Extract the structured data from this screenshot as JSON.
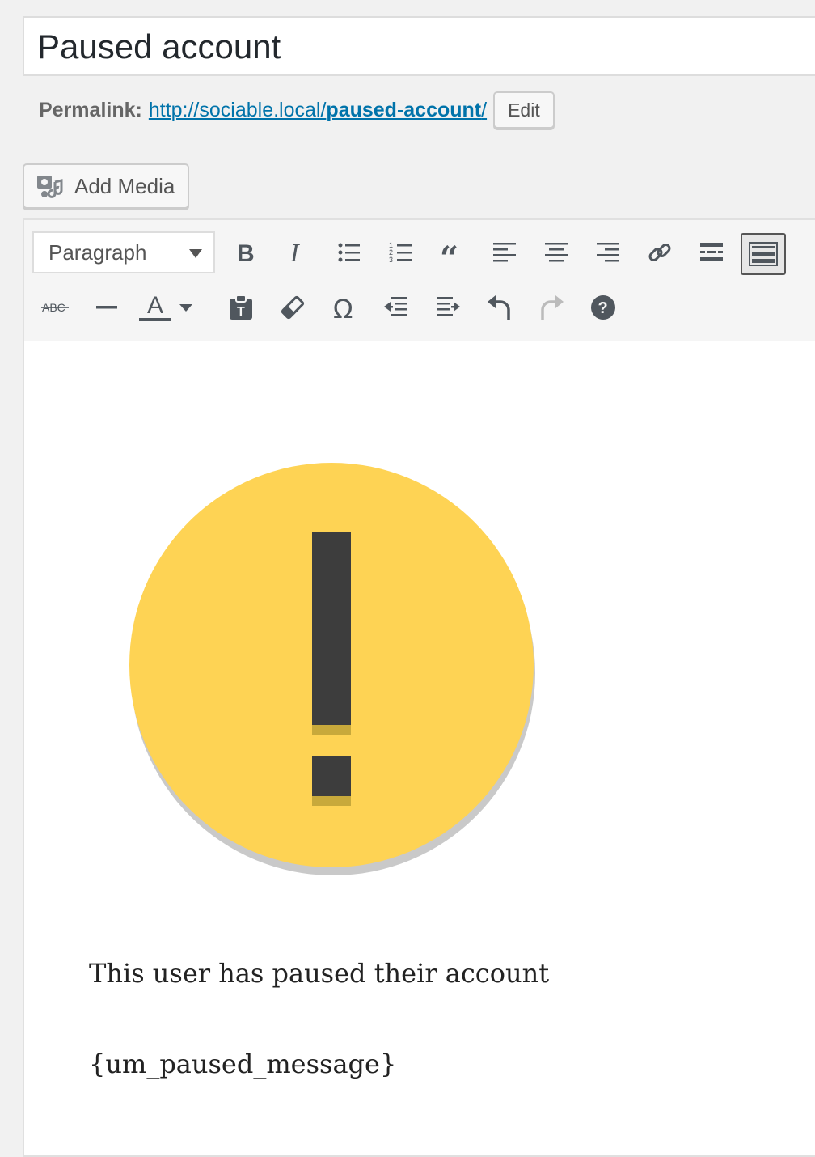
{
  "post": {
    "title": "Paused account"
  },
  "permalink": {
    "label": "Permalink:",
    "url_base": "http://sociable.local/",
    "url_slug": "paused-account",
    "url_trailing": "/",
    "edit_label": "Edit"
  },
  "media": {
    "add_media_label": "Add Media"
  },
  "toolbar": {
    "format_value": "Paragraph",
    "icons": [
      "bold-icon",
      "italic-icon",
      "bulleted-list-icon",
      "numbered-list-icon",
      "blockquote-icon",
      "align-left-icon",
      "align-center-icon",
      "align-right-icon",
      "link-icon",
      "read-more-icon",
      "toolbar-toggle-icon",
      "strikethrough-icon",
      "horizontal-line-icon",
      "text-color-icon",
      "paste-text-icon",
      "clear-formatting-icon",
      "special-character-icon",
      "outdent-icon",
      "indent-icon",
      "undo-icon",
      "redo-icon",
      "help-icon"
    ]
  },
  "content": {
    "paragraph_1": "This user has paused their account",
    "paragraph_2": "{um_paused_message}"
  },
  "colors": {
    "link": "#0073aa",
    "warning_yellow": "#fed354",
    "warning_mark": "#3d3d3d"
  }
}
